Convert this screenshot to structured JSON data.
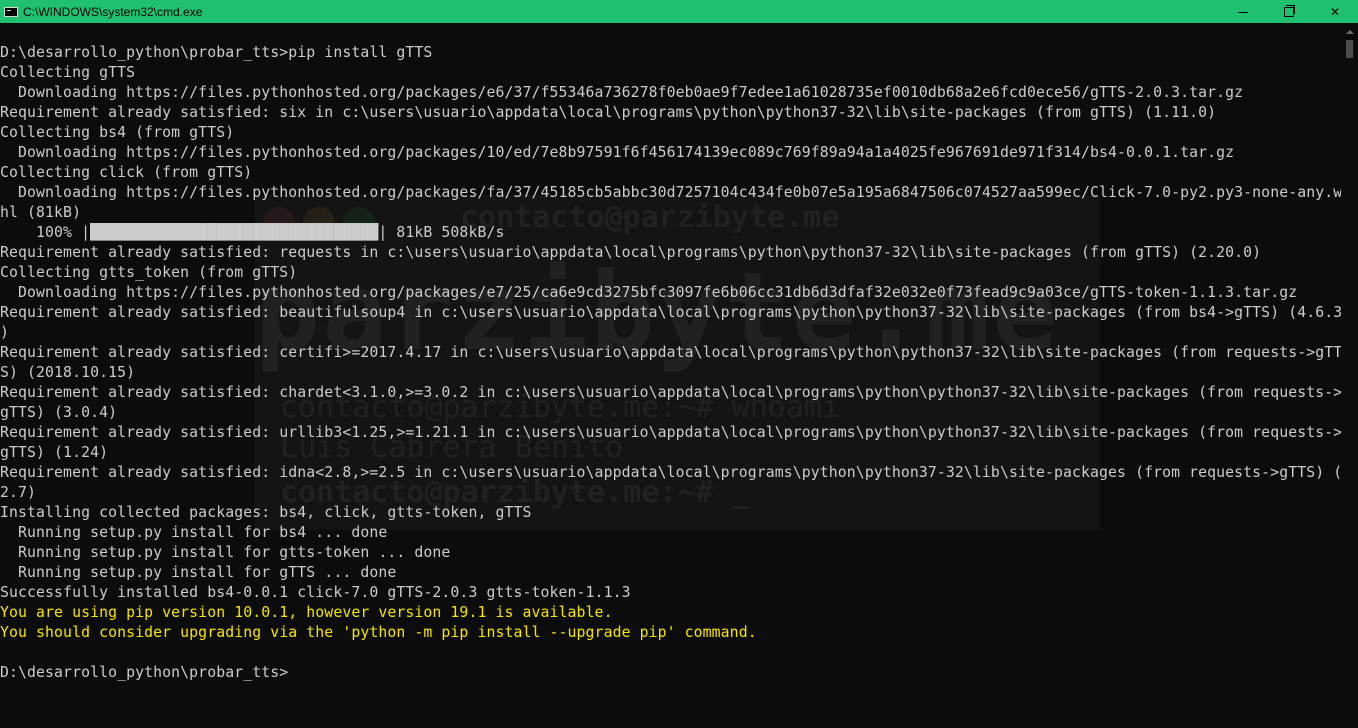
{
  "window": {
    "title": "C:\\WINDOWS\\system32\\cmd.exe",
    "titlebar_color": "#1fc06f",
    "icon": "cmd-icon",
    "buttons": [
      "minimize-icon",
      "restore-icon",
      "close-icon"
    ],
    "close_glyph": "✕"
  },
  "watermark": {
    "email": "contacto@parzibyte.me",
    "big": "parzibyte.me",
    "line1": "contacto@parzibyte.me:~# whoami",
    "line2": "Luis Cabrera Benito",
    "line3": "contacto@parzibyte.me:~# _",
    "dot_colors": [
      "#ff5f56",
      "#ffbd2e",
      "#27c93f"
    ]
  },
  "console": {
    "text_color": "#cccccc",
    "warning_color": "#f5e400",
    "lines": [
      "D:\\desarrollo_python\\probar_tts>pip install gTTS",
      "Collecting gTTS",
      "  Downloading https://files.pythonhosted.org/packages/e6/37/f55346a736278f0eb0ae9f7edee1a61028735ef0010db68a2e6fcd0ece56/gTTS-2.0.3.tar.gz",
      "Requirement already satisfied: six in c:\\users\\usuario\\appdata\\local\\programs\\python\\python37-32\\lib\\site-packages (from gTTS) (1.11.0)",
      "Collecting bs4 (from gTTS)",
      "  Downloading https://files.pythonhosted.org/packages/10/ed/7e8b97591f6f456174139ec089c769f89a94a1a4025fe967691de971f314/bs4-0.0.1.tar.gz",
      "Collecting click (from gTTS)",
      "  Downloading https://files.pythonhosted.org/packages/fa/37/45185cb5abbc30d7257104c434fe0b07e5a195a6847506c074527aa599ec/Click-7.0-py2.py3-none-any.w",
      "hl (81kB)",
      "    100% |████████████████████████████████| 81kB 508kB/s",
      "Requirement already satisfied: requests in c:\\users\\usuario\\appdata\\local\\programs\\python\\python37-32\\lib\\site-packages (from gTTS) (2.20.0)",
      "Collecting gtts_token (from gTTS)",
      "  Downloading https://files.pythonhosted.org/packages/e7/25/ca6e9cd3275bfc3097fe6b06cc31db6d3dfaf32e032e0f73fead9c9a03ce/gTTS-token-1.1.3.tar.gz",
      "Requirement already satisfied: beautifulsoup4 in c:\\users\\usuario\\appdata\\local\\programs\\python\\python37-32\\lib\\site-packages (from bs4->gTTS) (4.6.3",
      ")",
      "Requirement already satisfied: certifi>=2017.4.17 in c:\\users\\usuario\\appdata\\local\\programs\\python\\python37-32\\lib\\site-packages (from requests->gTT",
      "S) (2018.10.15)",
      "Requirement already satisfied: chardet<3.1.0,>=3.0.2 in c:\\users\\usuario\\appdata\\local\\programs\\python\\python37-32\\lib\\site-packages (from requests->",
      "gTTS) (3.0.4)",
      "Requirement already satisfied: urllib3<1.25,>=1.21.1 in c:\\users\\usuario\\appdata\\local\\programs\\python\\python37-32\\lib\\site-packages (from requests->",
      "gTTS) (1.24)",
      "Requirement already satisfied: idna<2.8,>=2.5 in c:\\users\\usuario\\appdata\\local\\programs\\python\\python37-32\\lib\\site-packages (from requests->gTTS) (",
      "2.7)",
      "Installing collected packages: bs4, click, gtts-token, gTTS",
      "  Running setup.py install for bs4 ... done",
      "  Running setup.py install for gtts-token ... done",
      "  Running setup.py install for gTTS ... done",
      "Successfully installed bs4-0.0.1 click-7.0 gTTS-2.0.3 gtts-token-1.1.3",
      "You are using pip version 10.0.1, however version 19.1 is available.",
      "You should consider upgrading via the 'python -m pip install --upgrade pip' command.",
      "",
      "D:\\desarrollo_python\\probar_tts>"
    ],
    "warning_line_indexes": [
      28,
      29
    ]
  }
}
